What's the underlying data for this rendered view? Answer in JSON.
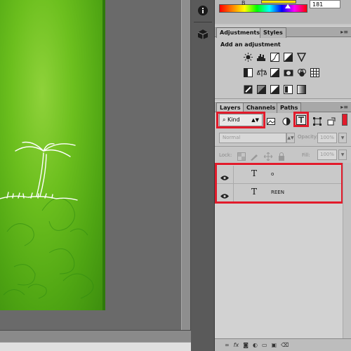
{
  "color_panel": {
    "channel_label": "B",
    "value": "181"
  },
  "adjustments_panel": {
    "tabs": [
      {
        "label": "Adjustments"
      },
      {
        "label": "Styles"
      }
    ],
    "title": "Add an adjustment",
    "row1": [
      "brightness-contrast-icon",
      "levels-icon",
      "curves-icon",
      "exposure-icon",
      "vibrance-icon"
    ],
    "row2": [
      "hue-saturation-icon",
      "color-balance-icon",
      "black-white-icon",
      "photo-filter-icon",
      "channel-mixer-icon",
      "color-lookup-icon"
    ],
    "row3": [
      "invert-icon",
      "posterize-icon",
      "threshold-icon",
      "selective-color-icon",
      "gradient-map-icon"
    ]
  },
  "layers_panel": {
    "tabs": [
      {
        "label": "Layers"
      },
      {
        "label": "Channels"
      },
      {
        "label": "Paths"
      }
    ],
    "filter_kind": "Kind",
    "blend_mode": "Normal",
    "opacity_label": "Opacity:",
    "opacity_value": "100%",
    "lock_label": "Lock:",
    "fill_label": "Fill:",
    "fill_value": "100%",
    "layers": [
      {
        "type_glyph": "T",
        "name": "o"
      },
      {
        "type_glyph": "T",
        "name": "REEN"
      }
    ],
    "footer_icons": [
      "link-icon",
      "fx",
      "mask-icon",
      "adjustment-layer-icon",
      "group-folder-icon",
      "new-layer-icon",
      "trash-icon"
    ],
    "footer_fx": "fx"
  },
  "highlight_color": "#e21b2b"
}
